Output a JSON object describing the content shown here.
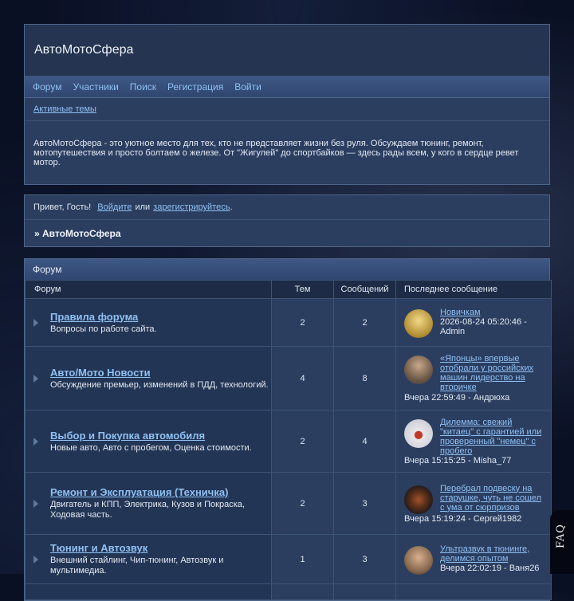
{
  "site": {
    "title": "АвтоМотоСфера"
  },
  "nav": [
    {
      "label": "Форум"
    },
    {
      "label": "Участники"
    },
    {
      "label": "Поиск"
    },
    {
      "label": "Регистрация"
    },
    {
      "label": "Войти"
    }
  ],
  "subnav": {
    "active_topics": "Активные темы"
  },
  "about": "АвтоМотоСфера - это уютное место для тех, кто не представляет жизни без руля. Обсуждаем тюнинг, ремонт, мотопутешествия и просто болтаем о железе. От \"Жигулей\" до спортбайков — здесь рады всем, у кого в сердце ревет мотор.",
  "greeting": {
    "hello": "Привет, Гость!",
    "login": "Войдите",
    "or": "или",
    "register": "зарегистрируйтесь",
    "dot": "."
  },
  "breadcrumb": "» АвтоМотоСфера",
  "forum": {
    "section_title": "Форум",
    "columns": {
      "forum": "Форум",
      "topics": "Тем",
      "posts": "Сообщений",
      "last": "Последнее сообщение"
    },
    "rows": [
      {
        "title": "Правила форума",
        "desc": "Вопросы по работе сайта.",
        "topics": "2",
        "posts": "2",
        "last_title": "Новичкам",
        "last_meta": "2026-08-24 05:20:46 - Admin",
        "avatar": "admin-avatar",
        "avatar_color": "#c9a74a"
      },
      {
        "title": "Авто/Мото Новости",
        "desc": "Обсуждение премьер, изменений в ПДД, технологий.",
        "topics": "4",
        "posts": "8",
        "last_title": "«Японцы» впервые отобрали у российских машин лидерство на вторичке",
        "last_meta": "Вчера 22:59:49 - Андрюха",
        "avatar": "user-avatar",
        "avatar_color": "#7a6a58"
      },
      {
        "title": "Выбор и Покупка автомобиля",
        "desc": "Новые авто, Авто с пробегом, Оценка стоимости.",
        "topics": "2",
        "posts": "4",
        "last_title": "Дилемма: свежий \"китаец\" с гарантией или проверенный \"немец\" с пробего",
        "last_meta": "Вчера 15:15:25 - Misha_77",
        "avatar": "car-avatar",
        "avatar_color": "#d8d8dc"
      },
      {
        "title": "Ремонт и Эксплуатация (Техничка)",
        "desc": "Двигатель и КПП, Электрика, Кузов и Покраска, Ходовая часть.",
        "topics": "2",
        "posts": "3",
        "last_title": "Перебрал подвеску на старушке, чуть не сошел с ума от сюрпризов",
        "last_meta": "Вчера 15:19:24 - Сергей1982",
        "avatar": "moto-avatar",
        "avatar_color": "#3a2a22"
      },
      {
        "title": "Тюнинг и Автозвук",
        "desc": "Внешний стайлинг, Чип-тюнинг, Автозвук и мультимедиа.",
        "topics": "1",
        "posts": "3",
        "last_title": "Ультразвук в тюнинге, делимся опытом",
        "last_meta": "Вчера 22:02:19 - Ваня26",
        "avatar": "user-avatar",
        "avatar_color": "#9a7a60"
      }
    ]
  },
  "faq": {
    "label": "FAQ"
  }
}
